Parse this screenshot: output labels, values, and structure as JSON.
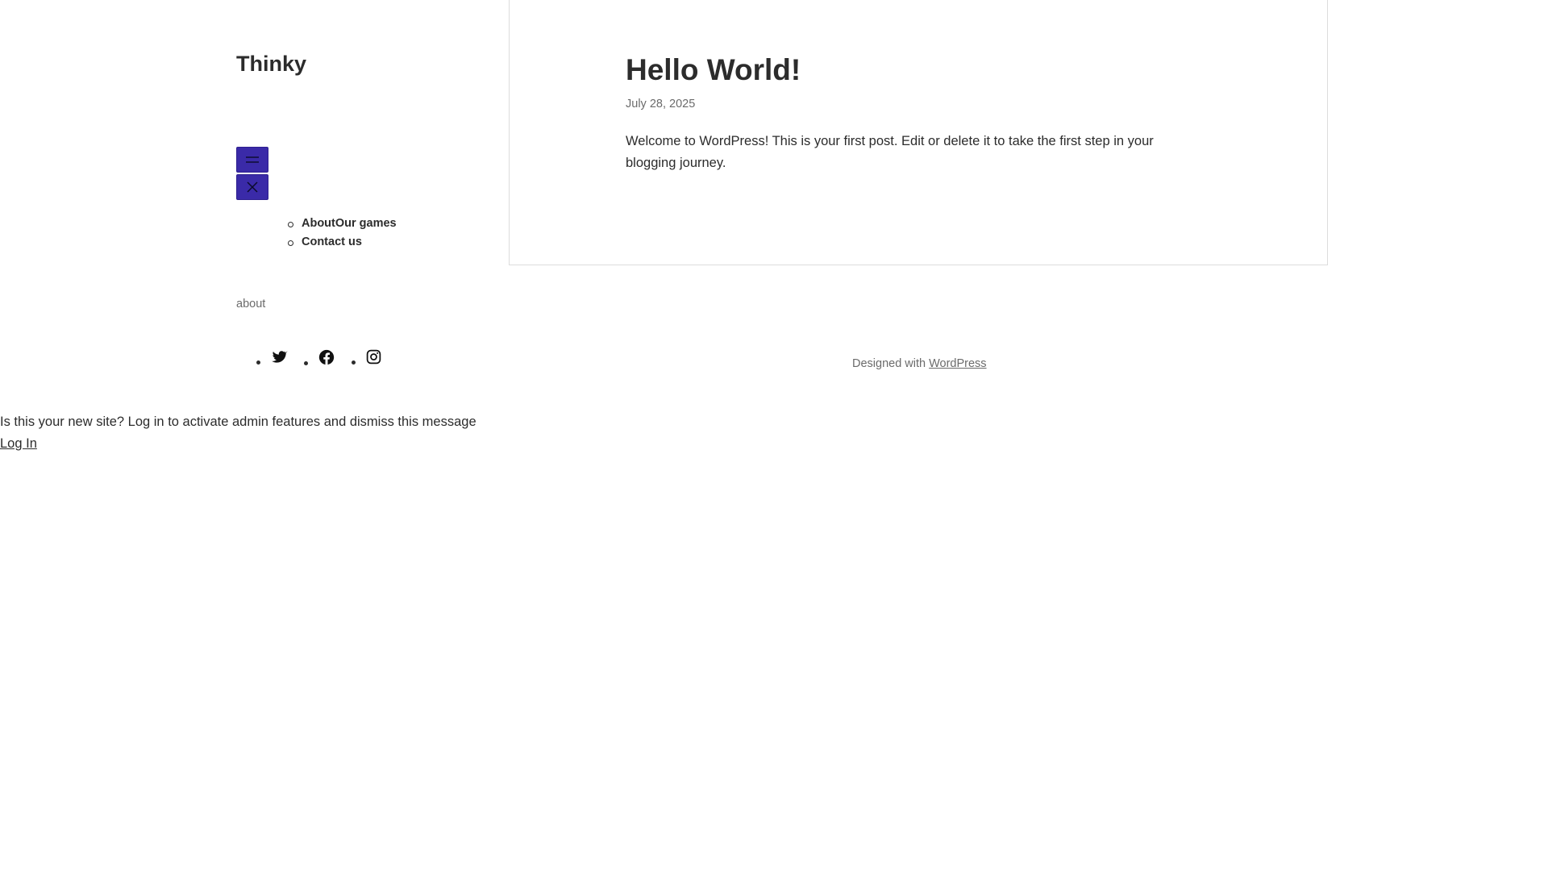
{
  "site": {
    "title": "Thinky"
  },
  "header": {
    "menu_open_icon": "hamburger-icon",
    "menu_close_icon": "close-icon",
    "accent_color": "#3a2aa8"
  },
  "navigation": {
    "items": [
      {
        "label": "AboutOur games"
      },
      {
        "label": "Contact us"
      }
    ]
  },
  "sidebar": {
    "about_text": "about",
    "social": [
      {
        "icon": "twitter-icon"
      },
      {
        "icon": "facebook-icon"
      },
      {
        "icon": "instagram-icon"
      }
    ]
  },
  "post": {
    "title": "Hello World!",
    "date": "July 28, 2025",
    "body": "Welcome to WordPress! This is your first post. Edit or delete it to take the first step in your blogging journey."
  },
  "footer": {
    "designed_with": "Designed with",
    "link_label": "WordPress"
  },
  "admin_notice": {
    "message": "Is this your new site? Log in to activate admin features and dismiss this message",
    "login_label": "Log In"
  }
}
